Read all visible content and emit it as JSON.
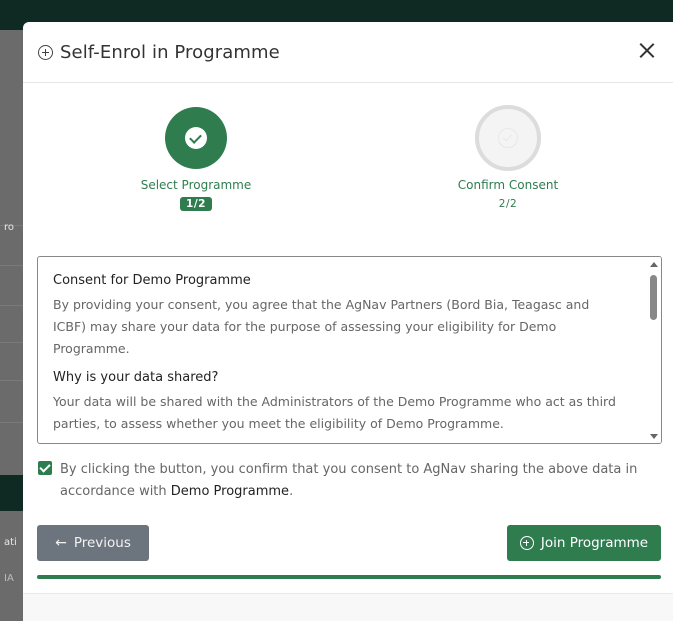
{
  "modal": {
    "title": "Self-Enrol in Programme",
    "icons": {
      "title": "plus-circle-icon",
      "close": "close-icon"
    }
  },
  "background": {
    "fragments": [
      "ro",
      "ati",
      "IA"
    ]
  },
  "stepper": {
    "steps": [
      {
        "label": "Select Programme",
        "count": "1/2",
        "state": "complete"
      },
      {
        "label": "Confirm Consent",
        "count": "2/2",
        "state": "pending"
      }
    ]
  },
  "consent": {
    "heading": "Consent for Demo Programme",
    "paragraph1": "By providing your consent, you agree that the AgNav Partners (Bord Bia, Teagasc and ICBF) may share your data for the purpose of assessing your eligibility for Demo Programme.",
    "heading2": "Why is your data shared?",
    "paragraph2": "Your data will be shared with the Administrators of the Demo Programme who act as third parties, to assess whether you meet the eligibility of Demo Programme."
  },
  "checkbox": {
    "checked": true,
    "text_before": "By clicking the button, you confirm that you consent to AgNav sharing the above data in accordance with ",
    "programme": "Demo Programme",
    "text_after": "."
  },
  "buttons": {
    "previous": "Previous",
    "join": "Join Programme"
  },
  "progress": {
    "percent": 100
  },
  "colors": {
    "accent": "#2f7d4f",
    "secondary": "#6c757d"
  }
}
